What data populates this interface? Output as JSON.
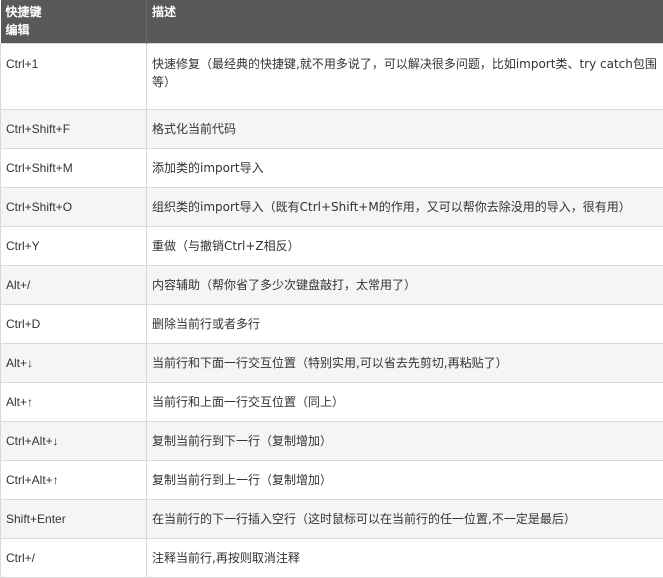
{
  "table": {
    "headers": {
      "shortcut": "快捷键",
      "shortcut_sub": "编辑",
      "description": "描述"
    },
    "rows": [
      {
        "key": "Ctrl+1",
        "desc": "快速修复（最经典的快捷键,就不用多说了，可以解决很多问题，比如import类、try catch包围等）"
      },
      {
        "key": "Ctrl+Shift+F",
        "desc": "格式化当前代码"
      },
      {
        "key": "Ctrl+Shift+M",
        "desc": "添加类的import导入"
      },
      {
        "key": "Ctrl+Shift+O",
        "desc": "组织类的import导入（既有Ctrl+Shift+M的作用，又可以帮你去除没用的导入，很有用）"
      },
      {
        "key": "Ctrl+Y",
        "desc": "重做（与撤销Ctrl+Z相反）"
      },
      {
        "key": "Alt+/",
        "desc": "内容辅助（帮你省了多少次键盘敲打，太常用了）"
      },
      {
        "key": "Ctrl+D",
        "desc": "删除当前行或者多行"
      },
      {
        "key": "Alt+↓",
        "desc": "当前行和下面一行交互位置（特别实用,可以省去先剪切,再粘贴了）"
      },
      {
        "key": "Alt+↑",
        "desc": "当前行和上面一行交互位置（同上）"
      },
      {
        "key": "Ctrl+Alt+↓",
        "desc": "复制当前行到下一行（复制增加）"
      },
      {
        "key": "Ctrl+Alt+↑",
        "desc": "复制当前行到上一行（复制增加）"
      },
      {
        "key": "Shift+Enter",
        "desc": "在当前行的下一行插入空行（这时鼠标可以在当前行的任一位置,不一定是最后）"
      },
      {
        "key": "Ctrl+/",
        "desc": "注释当前行,再按则取消注释"
      }
    ]
  }
}
